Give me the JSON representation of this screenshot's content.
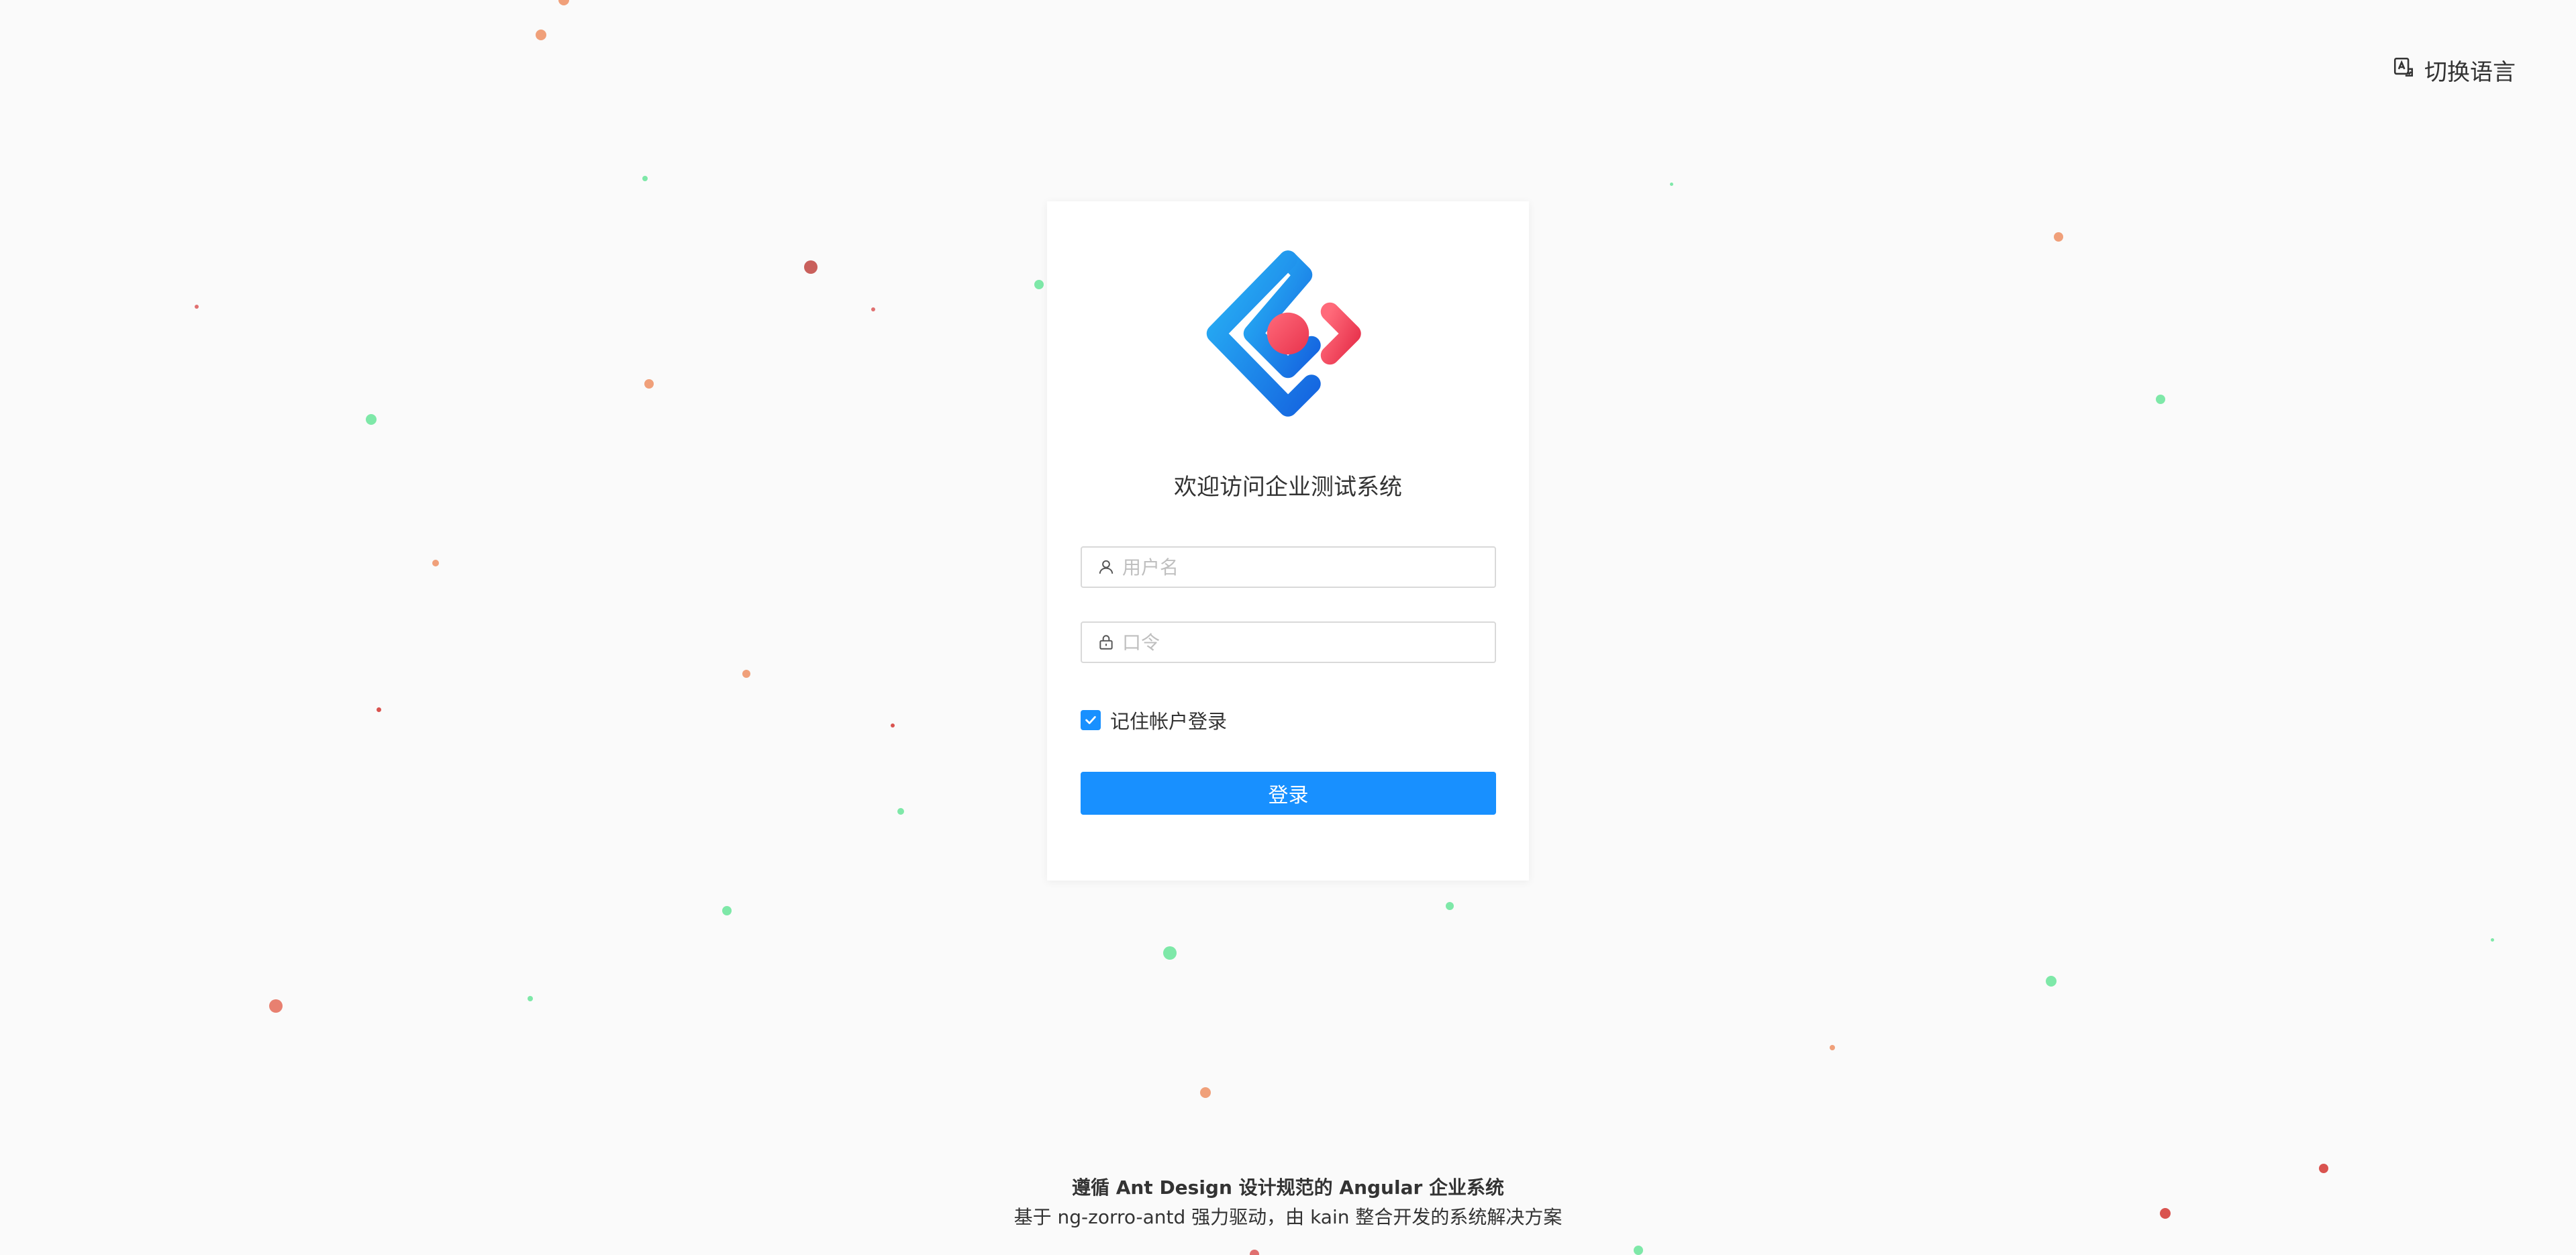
{
  "header": {
    "language_switch_label": "切换语言"
  },
  "login": {
    "welcome_text": "欢迎访问企业测试系统",
    "username_placeholder": "用户名",
    "password_placeholder": "口令",
    "remember_label": "记住帐户登录",
    "remember_checked": true,
    "login_button_label": "登录"
  },
  "footer": {
    "line1": "遵循 Ant Design 设计规范的 Angular 企业系统",
    "line2": "基于 ng-zorro-antd 强力驱动，由 kain 整合开发的系统解决方案"
  },
  "colors": {
    "primary": "#1890ff",
    "logo_blue": "#1e88e5",
    "logo_red": "#f0405a",
    "particle_green": "#7ee8a8",
    "particle_orange": "#f0a07a",
    "particle_red": "#d9534f"
  }
}
